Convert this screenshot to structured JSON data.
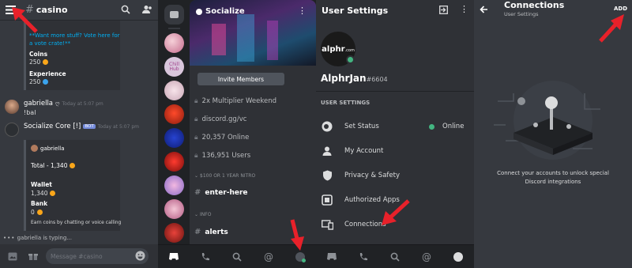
{
  "panel1": {
    "channel_name": "casino",
    "embed_top": {
      "text": "**Want more stuff? Vote here for a vote crate!**",
      "coins_label": "Coins",
      "coins_value": "250",
      "exp_label": "Experience",
      "exp_value": "250"
    },
    "msg1": {
      "author": "gabriella",
      "time": "Today at 5:07 pm",
      "text": "!bal"
    },
    "msg2": {
      "author": "Socialize Core [!]",
      "badge": "BOT",
      "time": "Today at 5:07 pm"
    },
    "embed_bal": {
      "author": "gabriella",
      "total": "Total - 1,340",
      "wallet_label": "Wallet",
      "wallet_value": "1,340",
      "bank_label": "Bank",
      "bank_value": "0",
      "footer": "Earn coins by chatting or voice calling"
    },
    "typing": "gabriella is typing...",
    "input_placeholder": "Message #casino"
  },
  "panel2": {
    "server_name": "Socialize",
    "invite_label": "Invite Members",
    "stats": [
      "2x Multiplier Weekend",
      "discord.gg/vc",
      "20,357 Online",
      "136,951 Users"
    ],
    "category1": "$100 OR 1 YEAR NITRO",
    "channel1": "enter-here",
    "category2": "INFO",
    "channel2": "alerts",
    "guild_label": "Chill Hub"
  },
  "panel3": {
    "title": "User Settings",
    "avatar_text": "alphr",
    "avatar_sub": ".com",
    "username": "AlphrJan",
    "discriminator": "#6604",
    "section": "USER SETTINGS",
    "items": [
      {
        "label": "Set Status",
        "status": "Online"
      },
      {
        "label": "My Account"
      },
      {
        "label": "Privacy & Safety"
      },
      {
        "label": "Authorized Apps"
      },
      {
        "label": "Connections"
      }
    ]
  },
  "panel4": {
    "title": "Connections",
    "subtitle": "User Settings",
    "add_label": "ADD",
    "empty_text": "Connect your accounts to unlock special Discord integrations"
  },
  "colors": {
    "accent": "#7289da",
    "online": "#43b581",
    "arrow": "#e8212a",
    "gold": "#faa61a"
  }
}
